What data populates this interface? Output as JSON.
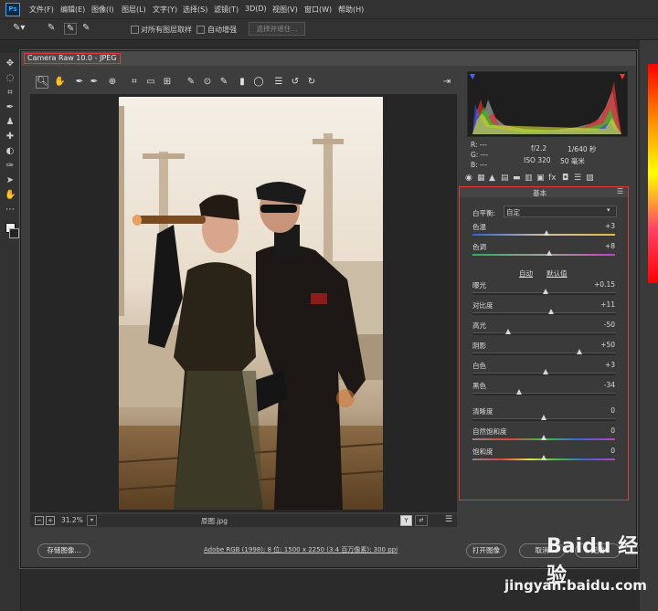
{
  "ps": {
    "logo": "Ps",
    "menus": [
      "文件(F)",
      "编辑(E)",
      "图像(I)",
      "图层(L)",
      "文字(Y)",
      "选择(S)",
      "滤镜(T)",
      "3D(D)",
      "视图(V)",
      "窗口(W)",
      "帮助(H)"
    ],
    "options": {
      "sample_all_layers": "对所有图层取样",
      "auto_enhance": "自动增强",
      "select_subject": "选择并遮住..."
    }
  },
  "dialog": {
    "title": "Camera Raw 10.0 - JPEG",
    "zoom": "31.2%",
    "filename": "原图.jpg",
    "workflow": "Adobe RGB (1998); 8 位; 1500 x 2250 (3.4 百万像素); 300 ppi",
    "save_label": "存储图像...",
    "open_label": "打开图像",
    "cancel_label": "取消",
    "done_label": "完成",
    "readout": {
      "r": "R: ---",
      "g": "G: ---",
      "b": "B: ---",
      "aperture": "f/2.2",
      "shutter": "1/640 秒",
      "iso": "ISO 320",
      "focal": "50 毫米"
    }
  },
  "panel": {
    "title": "基本",
    "wb_label": "白平衡:",
    "wb_value": "自定",
    "auto_label": "自动",
    "default_label": "默认值",
    "sliders": [
      {
        "id": "temp",
        "label": "色温",
        "value": "+3",
        "pos": 0.52
      },
      {
        "id": "tint",
        "label": "色调",
        "value": "+8",
        "pos": 0.54
      },
      {
        "id": "exposure",
        "label": "曝光",
        "value": "+0.15",
        "pos": 0.51
      },
      {
        "id": "contrast",
        "label": "对比度",
        "value": "+11",
        "pos": 0.55
      },
      {
        "id": "highlights",
        "label": "高光",
        "value": "-50",
        "pos": 0.25
      },
      {
        "id": "shadows",
        "label": "阴影",
        "value": "+50",
        "pos": 0.75
      },
      {
        "id": "whites",
        "label": "白色",
        "value": "+3",
        "pos": 0.51
      },
      {
        "id": "blacks",
        "label": "黑色",
        "value": "-34",
        "pos": 0.33
      },
      {
        "id": "clarity",
        "label": "清晰度",
        "value": "0",
        "pos": 0.5
      },
      {
        "id": "vibrance",
        "label": "自然饱和度",
        "value": "0",
        "pos": 0.5
      },
      {
        "id": "saturation",
        "label": "饱和度",
        "value": "0",
        "pos": 0.5
      }
    ]
  },
  "watermark": {
    "brand": "Baidu 经验",
    "url": "jingyan.baidu.com"
  }
}
